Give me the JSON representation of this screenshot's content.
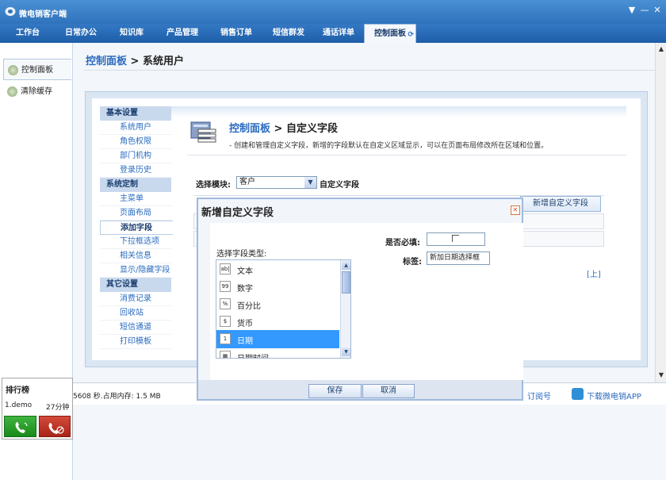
{
  "window": {
    "title": "微电销客户端",
    "minimize": "▼",
    "maximize": "—",
    "close": "✕"
  },
  "nav": {
    "tabs": [
      "工作台",
      "日常办公",
      "知识库",
      "产品管理",
      "销售订单",
      "短信群发",
      "通话详单",
      "控制面板"
    ],
    "active_index": 7
  },
  "left_panel": {
    "items": [
      "控制面板",
      "清除缓存"
    ]
  },
  "breadcrumb": {
    "root": "控制面板",
    "current": "> 系统用户"
  },
  "submenu": {
    "groups": [
      {
        "title": "基本设置",
        "items": [
          "系统用户",
          "角色权限",
          "部门机构",
          "登录历史"
        ]
      },
      {
        "title": "系统定制",
        "items": [
          "主菜单",
          "页面布局",
          "添加字段",
          "下拉框选项",
          "相关信息",
          "显示/隐藏字段"
        ]
      },
      {
        "title": "其它设置",
        "items": [
          "消费记录",
          "回收站",
          "短信通道",
          "打印模板"
        ]
      }
    ],
    "active": "添加字段"
  },
  "content": {
    "title_root": "控制面板",
    "title_current": "> 自定义字段",
    "description": "- 创建和管理自定义字段，新增的字段默认在自定义区域显示，可以在页面布局修改所在区域和位置。",
    "module_label": "选择模块:",
    "module_value": "客户",
    "module_suffix": "自定义字段",
    "add_button": "新增自定义字段",
    "up_link": "[上]"
  },
  "status": {
    "text": "5608 秒.占用内存: 1.5 MB",
    "subscribe": "订阅号",
    "download": "下载微电销APP"
  },
  "rank": {
    "title": "排行榜",
    "name": "1.demo",
    "time": "27分钟"
  },
  "dialog": {
    "title": "新增自定义字段",
    "close": "✕",
    "type_label": "选择字段类型:",
    "types": [
      {
        "icon": "ab|",
        "label": "文本"
      },
      {
        "icon": "99",
        "label": "数字"
      },
      {
        "icon": "%",
        "label": "百分比"
      },
      {
        "icon": "$",
        "label": "货币"
      },
      {
        "icon": "1",
        "label": "日期"
      },
      {
        "icon": "▦",
        "label": "日期时间"
      }
    ],
    "selected_type": "日期",
    "required_label": "是否必填:",
    "tag_label": "标签:",
    "tag_value": "新加日期选择框",
    "save": "保存",
    "cancel": "取消"
  },
  "colors": {
    "nav_blue": "#2f73bd",
    "link_blue": "#2a6bc0",
    "selected_row": "#3399ff",
    "call_green": "#1a8a1a",
    "hangup_red": "#a8241a"
  }
}
